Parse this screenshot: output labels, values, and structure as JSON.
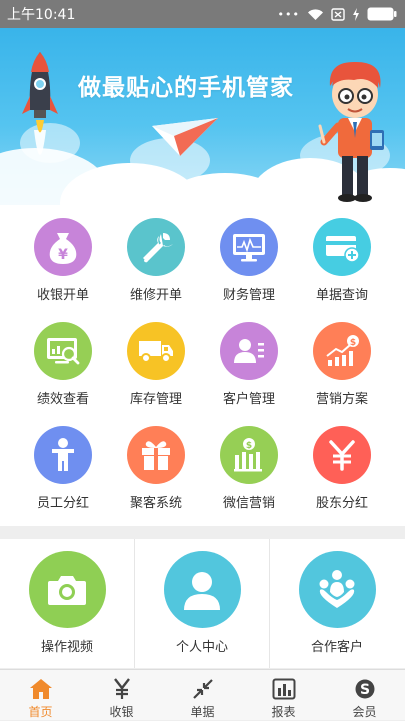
{
  "status_bar": {
    "time": "上午10:41",
    "dots": "•••"
  },
  "banner": {
    "slogan": "做最贴心的手机管家"
  },
  "grid": {
    "items": [
      {
        "label": "收银开单",
        "icon": "money-bag-icon",
        "color": "#c784d9"
      },
      {
        "label": "维修开单",
        "icon": "wrench-icon",
        "color": "#5ac4cc"
      },
      {
        "label": "财务管理",
        "icon": "monitor-chart-icon",
        "color": "#6f8ff0"
      },
      {
        "label": "单据查询",
        "icon": "card-add-icon",
        "color": "#46cde2"
      },
      {
        "label": "绩效查看",
        "icon": "screen-search-icon",
        "color": "#96cf55"
      },
      {
        "label": "库存管理",
        "icon": "truck-icon",
        "color": "#f7c325"
      },
      {
        "label": "客户管理",
        "icon": "contact-card-icon",
        "color": "#c784d9"
      },
      {
        "label": "营销方案",
        "icon": "growth-chart-icon",
        "color": "#ff7f57"
      },
      {
        "label": "员工分红",
        "icon": "person-icon",
        "color": "#6f8ff0"
      },
      {
        "label": "聚客系统",
        "icon": "gift-icon",
        "color": "#ff7f57"
      },
      {
        "label": "微信营销",
        "icon": "coin-bars-icon",
        "color": "#96cf55"
      },
      {
        "label": "股东分红",
        "icon": "yen-icon",
        "color": "#ff6057"
      }
    ]
  },
  "quick": {
    "items": [
      {
        "label": "操作视频",
        "icon": "camera-icon",
        "color": "#8fcf54"
      },
      {
        "label": "个人中心",
        "icon": "user-icon",
        "color": "#52c6dd"
      },
      {
        "label": "合作客户",
        "icon": "partners-icon",
        "color": "#52c6dd"
      }
    ]
  },
  "tabbar": {
    "active_color": "#f08a2c",
    "items": [
      {
        "label": "首页",
        "icon": "home-icon"
      },
      {
        "label": "收银",
        "icon": "yen-sign-icon"
      },
      {
        "label": "单据",
        "icon": "arrows-icon"
      },
      {
        "label": "报表",
        "icon": "bar-chart-icon"
      },
      {
        "label": "会员",
        "icon": "skype-icon"
      }
    ]
  }
}
